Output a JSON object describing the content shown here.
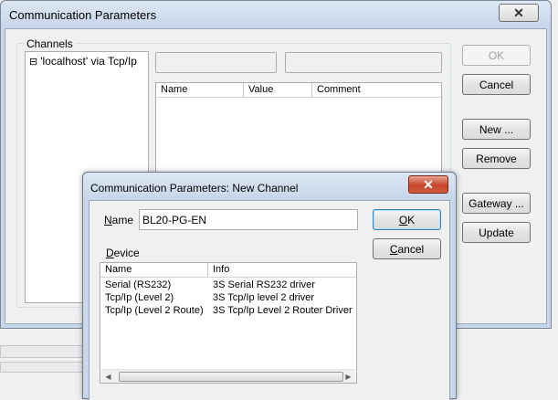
{
  "main_dialog": {
    "title": "Communication Parameters",
    "close_glyph": "✕",
    "channels_label": "Channels",
    "tree_item": "'localhost' via Tcp/Ip",
    "tree_expander": "⊟",
    "table_headers": [
      "Name",
      "Value",
      "Comment"
    ],
    "buttons": {
      "ok": "OK",
      "cancel": "Cancel",
      "new": "New ...",
      "remove": "Remove",
      "gateway": "Gateway ...",
      "update": "Update"
    }
  },
  "new_channel_dialog": {
    "title": "Communication Parameters: New Channel",
    "close_glyph": "✕",
    "name_label_first": "N",
    "name_label_rest": "ame",
    "name_value": "BL20-PG-EN",
    "ok_label_first": "O",
    "ok_label_rest": "K",
    "cancel_label_first": "C",
    "cancel_label_rest": "ancel",
    "device_label_first": "D",
    "device_label_rest": "evice",
    "device_headers": [
      "Name",
      "Info"
    ],
    "devices": [
      {
        "name": "Serial (RS232)",
        "info": "3S Serial RS232 driver"
      },
      {
        "name": "Tcp/Ip (Level 2)",
        "info": "3S Tcp/Ip level 2 driver"
      },
      {
        "name": "Tcp/Ip (Level 2 Route)",
        "info": "3S Tcp/Ip Level 2 Router Driver"
      }
    ],
    "scroll_left_glyph": "◀",
    "scroll_right_glyph": "▶"
  }
}
